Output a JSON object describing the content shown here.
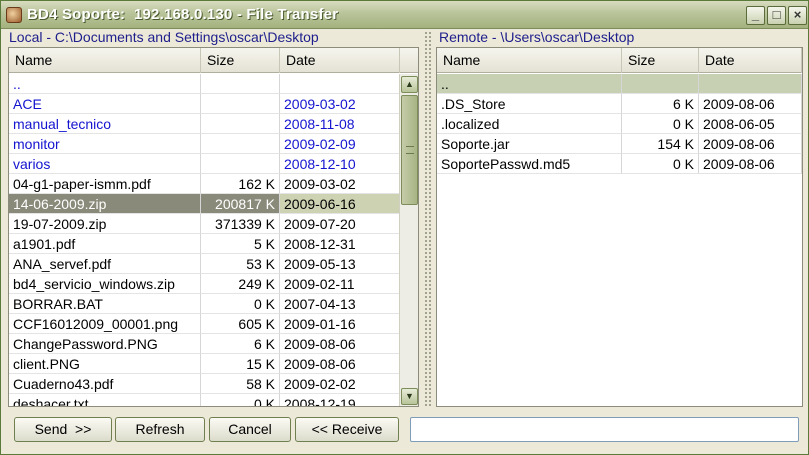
{
  "window": {
    "title": "BD4 Soporte:  192.168.0.130 - File Transfer",
    "controls": {
      "minimize": "_",
      "maximize": "□",
      "close": "×"
    }
  },
  "local": {
    "title": "Local - C:\\Documents and Settings\\oscar\\Desktop",
    "columns": {
      "name": "Name",
      "size": "Size",
      "date": "Date"
    },
    "rows": [
      {
        "name": "..",
        "size": "",
        "date": "",
        "type": "dir"
      },
      {
        "name": "ACE",
        "size": "",
        "date": "2009-03-02",
        "type": "dir"
      },
      {
        "name": "manual_tecnico",
        "size": "",
        "date": "2008-11-08",
        "type": "dir"
      },
      {
        "name": "monitor",
        "size": "",
        "date": "2009-02-09",
        "type": "dir"
      },
      {
        "name": "varios",
        "size": "",
        "date": "2008-12-10",
        "type": "dir"
      },
      {
        "name": "04-g1-paper-ismm.pdf",
        "size": "162 K",
        "date": "2009-03-02",
        "type": "file"
      },
      {
        "name": "14-06-2009.zip",
        "size": "200817 K",
        "date": "2009-06-16",
        "type": "file",
        "selected": true
      },
      {
        "name": "19-07-2009.zip",
        "size": "371339 K",
        "date": "2009-07-20",
        "type": "file"
      },
      {
        "name": "a1901.pdf",
        "size": "5 K",
        "date": "2008-12-31",
        "type": "file"
      },
      {
        "name": "ANA_servef.pdf",
        "size": "53 K",
        "date": "2009-05-13",
        "type": "file"
      },
      {
        "name": "bd4_servicio_windows.zip",
        "size": "249 K",
        "date": "2009-02-11",
        "type": "file"
      },
      {
        "name": "BORRAR.BAT",
        "size": "0 K",
        "date": "2007-04-13",
        "type": "file"
      },
      {
        "name": "CCF16012009_00001.png",
        "size": "605 K",
        "date": "2009-01-16",
        "type": "file"
      },
      {
        "name": "ChangePassword.PNG",
        "size": "6 K",
        "date": "2009-08-06",
        "type": "file"
      },
      {
        "name": "client.PNG",
        "size": "15 K",
        "date": "2009-08-06",
        "type": "file"
      },
      {
        "name": "Cuaderno43.pdf",
        "size": "58 K",
        "date": "2009-02-02",
        "type": "file"
      },
      {
        "name": "deshacer.txt",
        "size": "0 K",
        "date": "2008-12-19",
        "type": "file"
      }
    ]
  },
  "remote": {
    "title": "Remote - \\Users\\oscar\\Desktop",
    "columns": {
      "name": "Name",
      "size": "Size",
      "date": "Date"
    },
    "rows": [
      {
        "name": "..",
        "size": "",
        "date": "",
        "type": "parent"
      },
      {
        "name": ".DS_Store",
        "size": "6 K",
        "date": "2009-08-06",
        "type": "file"
      },
      {
        "name": ".localized",
        "size": "0 K",
        "date": "2008-06-05",
        "type": "file"
      },
      {
        "name": "Soporte.jar",
        "size": "154 K",
        "date": "2009-08-06",
        "type": "file"
      },
      {
        "name": "SoportePasswd.md5",
        "size": "0 K",
        "date": "2009-08-06",
        "type": "file"
      }
    ]
  },
  "scrollbar": {
    "up": "▲",
    "down": "▼"
  },
  "buttons": {
    "send": "Send  >>",
    "refresh": "Refresh",
    "cancel": "Cancel",
    "receive": "<< Receive"
  },
  "status": {
    "value": ""
  },
  "colors": {
    "dir_text": "#1414d0",
    "selected_bg": "#8a8a7a",
    "title_text": "#1e1e8c"
  }
}
